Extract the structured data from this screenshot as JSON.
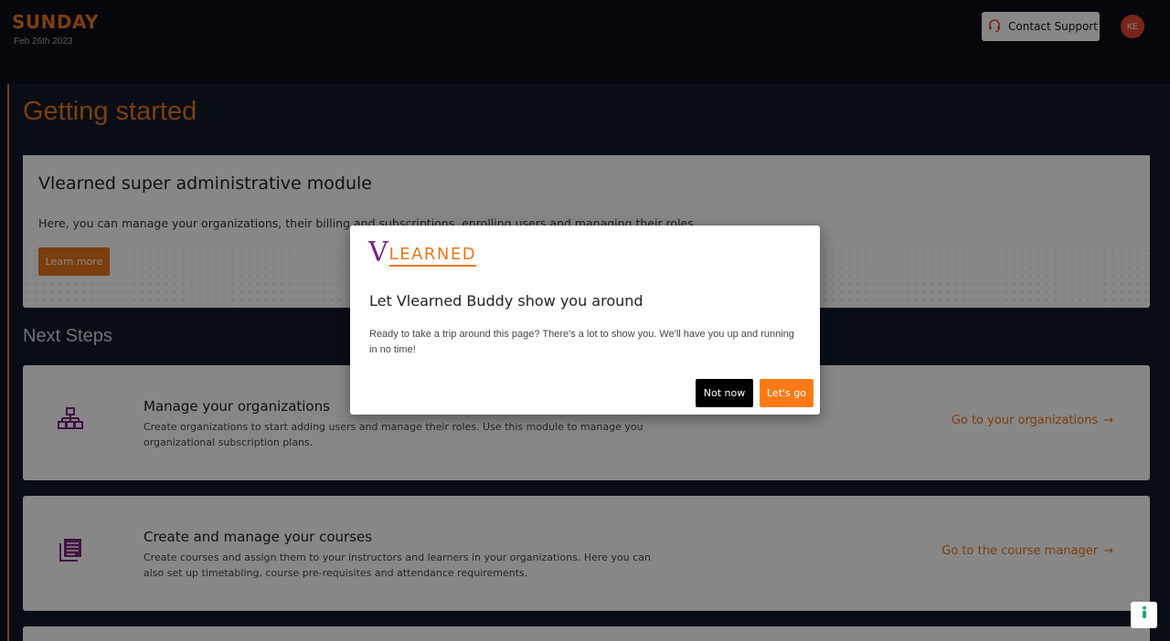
{
  "header": {
    "day": "SUNDAY",
    "date": "Feb 26th 2023",
    "support_label": "Contact Support",
    "avatar_initials": "KE"
  },
  "main": {
    "page_title": "Getting started",
    "hero": {
      "title": "Vlearned super administrative module",
      "description": "Here, you can manage your organizations, their billing and subscriptions, enrolling users and managing their roles.",
      "button_label": "Learn more"
    },
    "next_steps_title": "Next Steps",
    "steps": [
      {
        "title": "Manage your organizations",
        "description": "Create organizations to start adding users and manage their roles. Use this module to manage you organizational subscription plans.",
        "link_label": "Go to your organizations",
        "icon": "sitemap-icon"
      },
      {
        "title": "Create and manage your courses",
        "description": "Create courses and assign them to your instructors and learners in your organizations. Here you can also set up timetabling, course pre-requisites and attendance requirements.",
        "link_label": "Go to the course manager",
        "icon": "course-list-icon"
      }
    ]
  },
  "modal": {
    "logo_v": "V",
    "logo_rest": "LEARNED",
    "title": "Let Vlearned Buddy show you around",
    "body": "Ready to take a trip around this page? There's a lot to show you. We'll have you up and running in no time!",
    "not_now_label": "Not now",
    "lets_go_label": "Let's go"
  },
  "colors": {
    "accent": "#e8761e",
    "brand_purple": "#7a2580",
    "background": "#0a0f1a"
  }
}
